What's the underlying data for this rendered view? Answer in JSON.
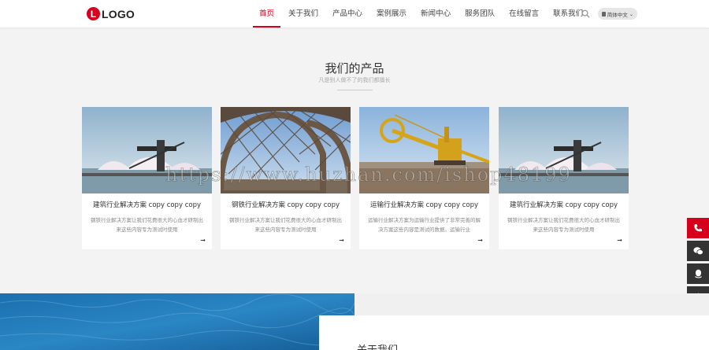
{
  "header": {
    "logo_mark": "L",
    "logo_text": "LOGO",
    "nav": [
      {
        "label": "首页",
        "active": true
      },
      {
        "label": "关于我们"
      },
      {
        "label": "产品中心"
      },
      {
        "label": "案例展示"
      },
      {
        "label": "新闻中心"
      },
      {
        "label": "服务团队"
      },
      {
        "label": "在线留言"
      },
      {
        "label": "联系我们"
      }
    ],
    "search_icon": "search-icon",
    "language": "简体中文"
  },
  "products": {
    "title": "我们的产品",
    "subtitle": "凡是别人做不了的我们都擅长",
    "cards": [
      {
        "title": "建筑行业解决方案 copy copy copy",
        "desc": "钢铁行业解决方案让我们花费很大的心血才研制出来这些内容专为测试时使用",
        "image": "salt-dome-harbor"
      },
      {
        "title": "钢铁行业解决方案 copy copy copy",
        "desc": "钢铁行业解决方案让我们花费很大的心血才研制出来这些内容专为测试时使用",
        "image": "steel-lattice-arch"
      },
      {
        "title": "运输行业解决方案 copy copy copy",
        "desc": "运输行业解决方案为运输行业提供了非常完善的解决方案这些内容是测试的数据。运输行业",
        "image": "bucket-wheel-excavator"
      },
      {
        "title": "建筑行业解决方案 copy copy copy",
        "desc": "钢铁行业解决方案让我们花费很大的心血才研制出来这些内容专为测试时使用",
        "image": "salt-dome-harbor"
      }
    ]
  },
  "watermark": "https://www.huzhan.com/ishop48199",
  "side_tools": [
    {
      "icon": "phone-icon"
    },
    {
      "icon": "wechat-icon"
    },
    {
      "icon": "qq-icon"
    },
    {
      "icon": "back-to-top-icon"
    }
  ],
  "about": {
    "title": "关于我们"
  },
  "colors": {
    "accent": "#d6001c",
    "page_bg": "#f3f3f3"
  }
}
